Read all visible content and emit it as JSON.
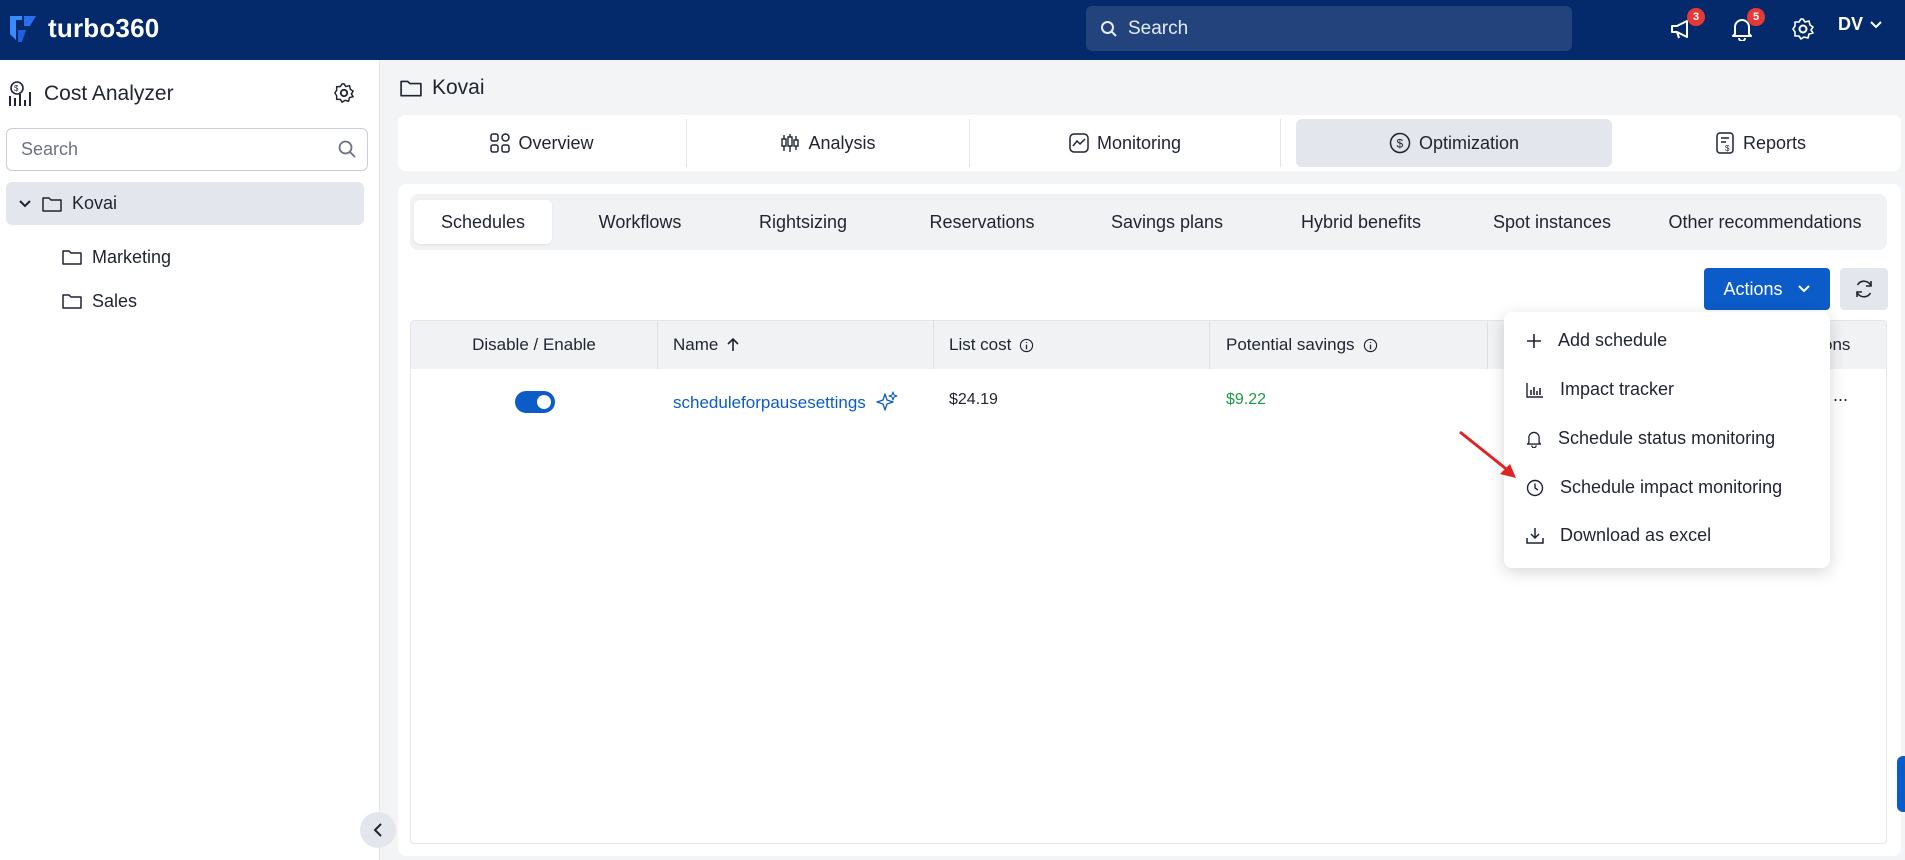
{
  "app": {
    "logo_text": "turbo360",
    "brand_color": "#052a6b",
    "accent_color": "#0b5cc8"
  },
  "topbar": {
    "search_placeholder": "Search",
    "announcements_badge": "3",
    "notifications_badge": "5",
    "user_initials": "DV"
  },
  "sidebar": {
    "title": "Cost Analyzer",
    "search_placeholder": "Search",
    "tree": [
      {
        "label": "Kovai",
        "expanded": true,
        "selected": true
      },
      {
        "label": "Marketing"
      },
      {
        "label": "Sales"
      }
    ]
  },
  "breadcrumb": {
    "current": "Kovai"
  },
  "main_tabs": [
    {
      "label": "Overview",
      "icon": "grid-icon"
    },
    {
      "label": "Analysis",
      "icon": "candlestick-icon"
    },
    {
      "label": "Monitoring",
      "icon": "line-chart-icon"
    },
    {
      "label": "Optimization",
      "icon": "dollar-circle-icon",
      "active": true
    },
    {
      "label": "Reports",
      "icon": "report-icon"
    }
  ],
  "sub_tabs": [
    {
      "label": "Schedules",
      "active": true
    },
    {
      "label": "Workflows"
    },
    {
      "label": "Rightsizing"
    },
    {
      "label": "Reservations"
    },
    {
      "label": "Savings plans"
    },
    {
      "label": "Hybrid benefits"
    },
    {
      "label": "Spot instances"
    },
    {
      "label": "Other recommendations"
    }
  ],
  "toolbar": {
    "actions_label": "Actions"
  },
  "table": {
    "columns": [
      "Disable / Enable",
      "Name",
      "List cost",
      "Potential savings",
      "ons"
    ],
    "rows": [
      {
        "enabled": true,
        "name": "scheduleforpausesettings",
        "list_cost": "$24.19",
        "potential_savings": "$9.22",
        "overflow": "..."
      }
    ]
  },
  "actions_menu": [
    {
      "label": "Add schedule",
      "icon": "plus-icon"
    },
    {
      "label": "Impact tracker",
      "icon": "bar-chart-icon"
    },
    {
      "label": "Schedule status monitoring",
      "icon": "bell-icon"
    },
    {
      "label": "Schedule impact monitoring",
      "icon": "clock-icon"
    },
    {
      "label": "Download as excel",
      "icon": "download-icon"
    }
  ]
}
